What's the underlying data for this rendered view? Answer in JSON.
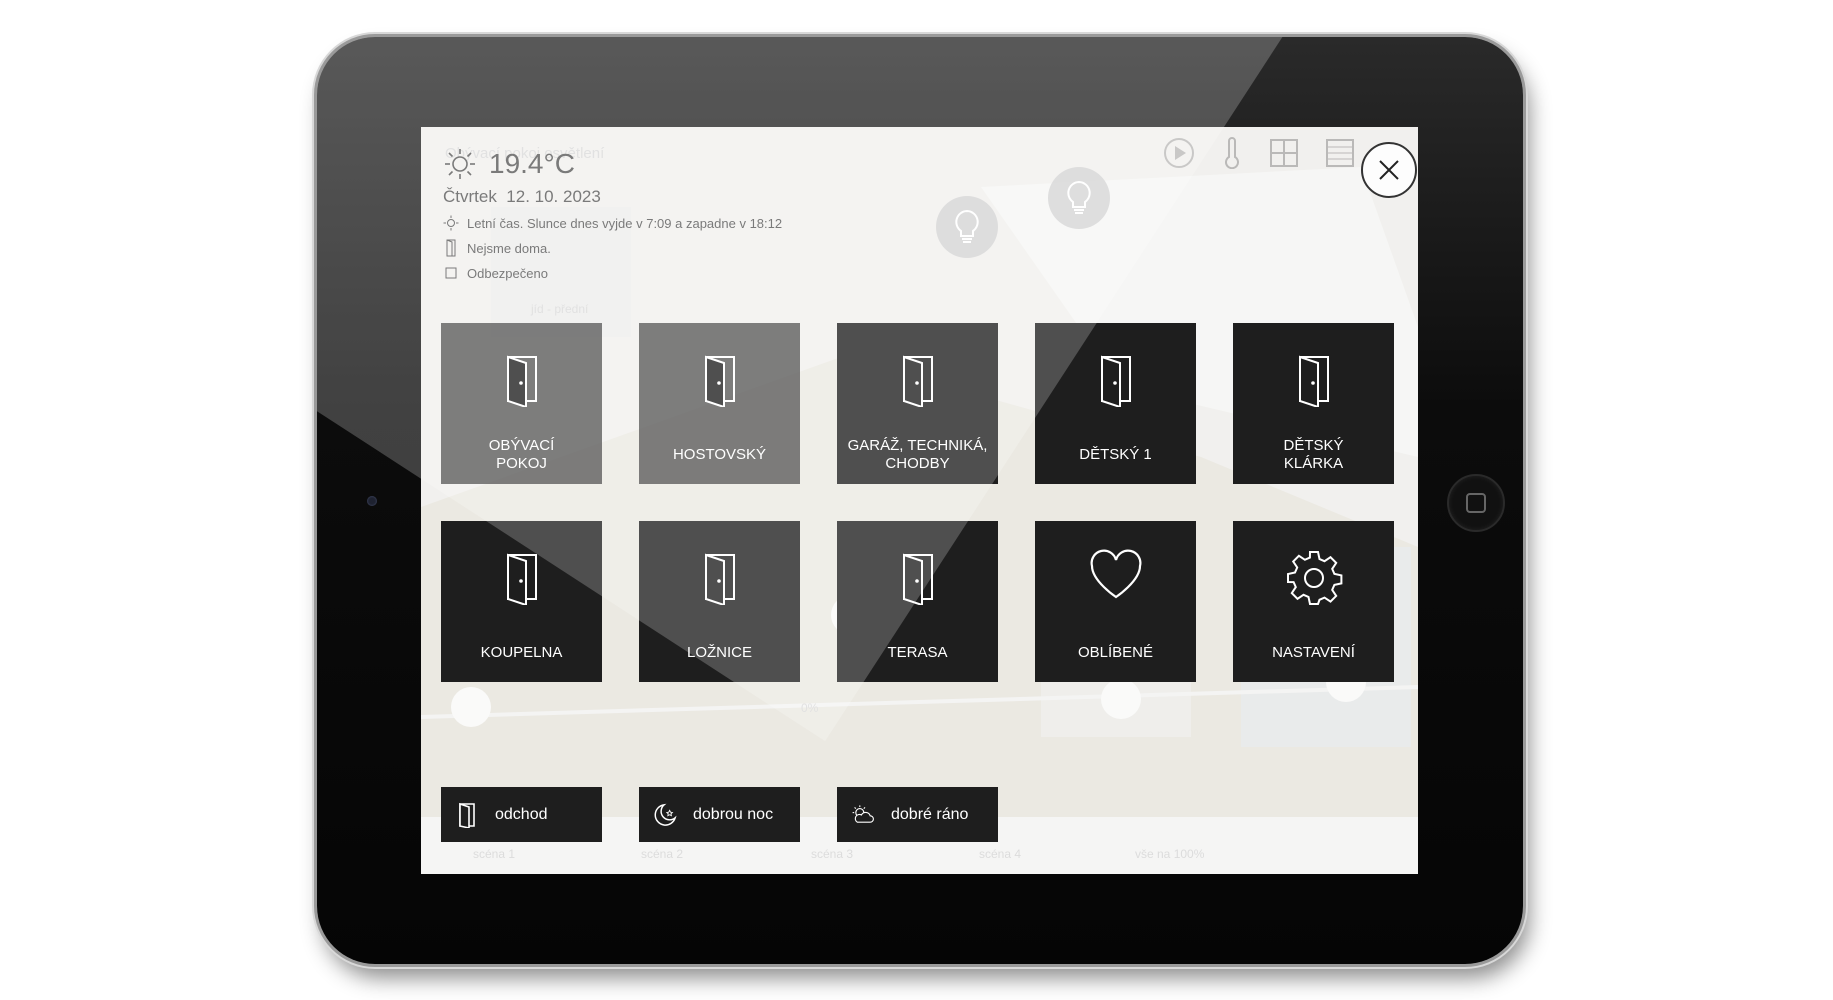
{
  "weather": {
    "temperature": "19.4°C",
    "day": "Čtvrtek",
    "date": "12. 10. 2023",
    "sun_info": "Letní čas. Slunce dnes vyjde v 7:09 a zapadne v 18:12",
    "presence": "Nejsme doma.",
    "security": "Odbezpečeno"
  },
  "background": {
    "faded_title": "Obývací pokoj osvětlení",
    "faded_caption": "jíd - přední",
    "percent_label": "0%",
    "scene_labels": [
      "scéna 1",
      "scéna 2",
      "scéna 3",
      "scéna 4",
      "vše na 100%"
    ]
  },
  "rooms": [
    {
      "label": "OBÝVACÍ\nPOKOJ",
      "icon": "door-icon"
    },
    {
      "label": "HOSTOVSKÝ",
      "icon": "door-icon"
    },
    {
      "label": "GARÁŽ, TECHNIKÁ,\nCHODBY",
      "icon": "door-icon"
    },
    {
      "label": "DĚTSKÝ 1",
      "icon": "door-icon"
    },
    {
      "label": "DĚTSKÝ\nKLÁRKA",
      "icon": "door-icon"
    },
    {
      "label": "KOUPELNA",
      "icon": "door-icon"
    },
    {
      "label": "LOŽNICE",
      "icon": "door-icon"
    },
    {
      "label": "TERASA",
      "icon": "door-icon"
    },
    {
      "label": "OBLÍBENÉ",
      "icon": "heart-icon"
    },
    {
      "label": "NASTAVENÍ",
      "icon": "gear-icon"
    }
  ],
  "scenes": [
    {
      "label": "odchod",
      "icon": "door-icon"
    },
    {
      "label": "dobrou noc",
      "icon": "moon-icon"
    },
    {
      "label": "dobré ráno",
      "icon": "sun-cloud-icon"
    }
  ],
  "colors": {
    "tile_bg": "#1e1e1e",
    "tile_text": "#ffffff",
    "frame": "#0c0c0c"
  }
}
